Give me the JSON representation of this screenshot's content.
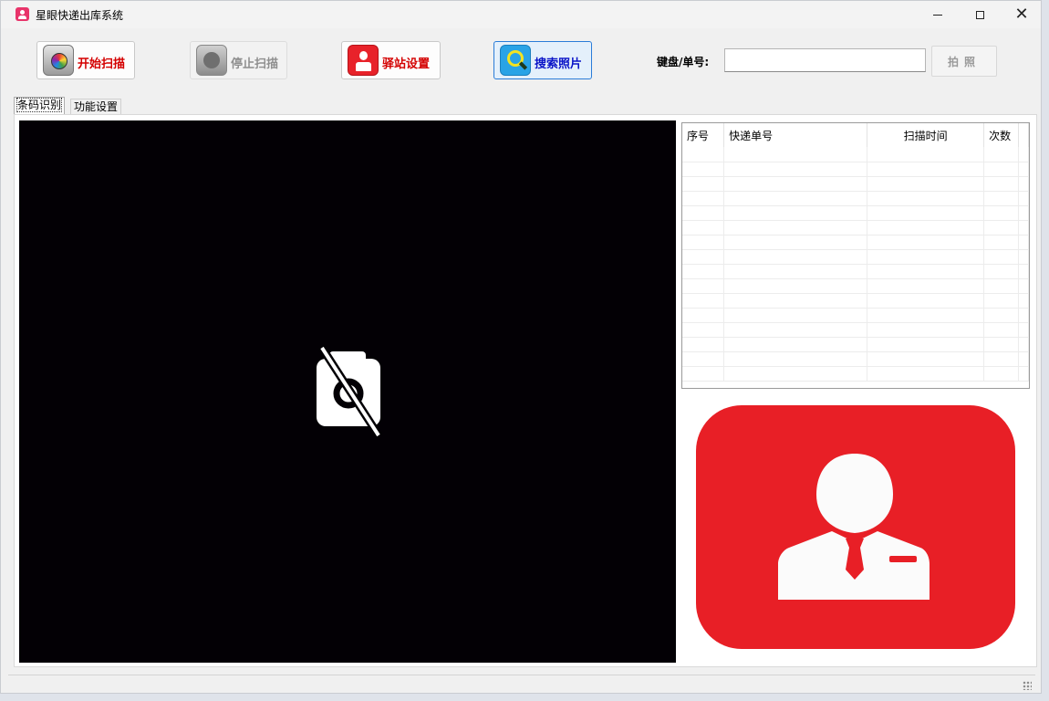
{
  "window": {
    "title": "星眼快递出库系统",
    "close_glyph": "✕"
  },
  "toolbar": {
    "start_scan": "开始扫描",
    "stop_scan": "停止扫描",
    "station_settings": "驿站设置",
    "search_photos": "搜索照片",
    "keyboard_label": "键盘/单号:",
    "keyboard_value": "",
    "photo_button": "拍照",
    "colors": {
      "start": "#d40000",
      "stop": "#8f8f8f",
      "station": "#d40000",
      "search": "#0a14c8"
    }
  },
  "tabs": [
    "条码识别",
    "功能设置"
  ],
  "table": {
    "columns": [
      "序号",
      "快递单号",
      "扫描时间",
      "次数"
    ],
    "rows": []
  },
  "icons": {
    "video": "camera-off-icon",
    "avatar": "courier-avatar-icon",
    "avatar_color": "#e81f26"
  }
}
